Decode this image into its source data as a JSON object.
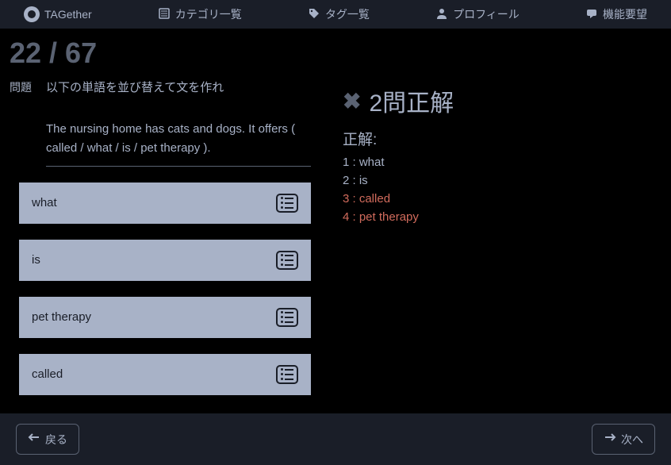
{
  "header": {
    "logo": "TAGether",
    "nav": [
      {
        "label": "カテゴリ一覧"
      },
      {
        "label": "タグ一覧"
      },
      {
        "label": "プロフィール"
      },
      {
        "label": "機能要望"
      }
    ]
  },
  "progress": "22 / 67",
  "question": {
    "label": "問題",
    "instruction": "以下の単語を並び替えて文を作れ",
    "sentence": "The nursing home has cats and dogs. It offers ( called / what / is / pet therapy )."
  },
  "user_answers": [
    "what",
    "is",
    "pet therapy",
    "called"
  ],
  "result": {
    "title": "2問正解",
    "correct_label": "正解:",
    "items": [
      {
        "text": "1 : what",
        "wrong": false
      },
      {
        "text": "2 : is",
        "wrong": false
      },
      {
        "text": "3 : called",
        "wrong": true
      },
      {
        "text": "4 : pet therapy",
        "wrong": true
      }
    ]
  },
  "footer": {
    "back": "戻る",
    "next": "次へ"
  }
}
